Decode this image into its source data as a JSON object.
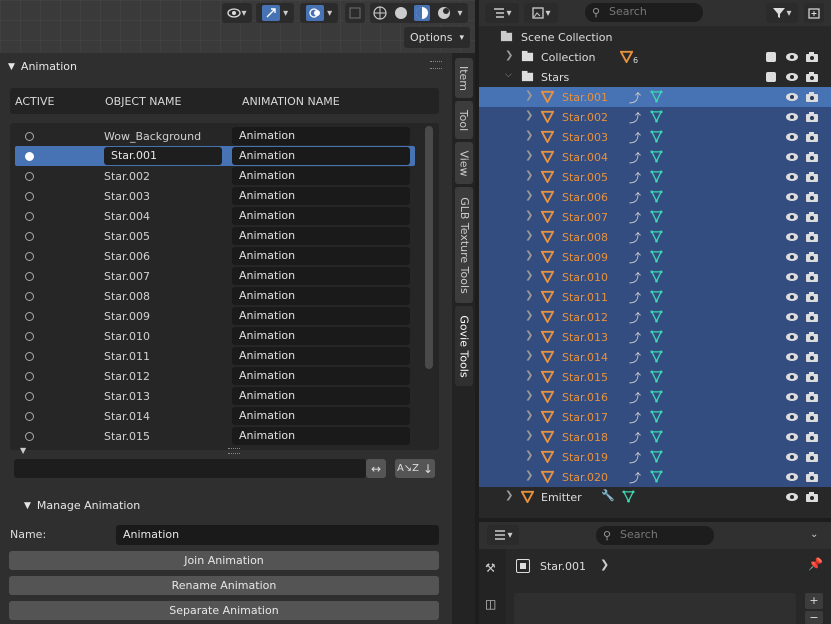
{
  "viewport": {
    "options_label": "Options"
  },
  "panel": {
    "animation_section": "Animation",
    "columns": {
      "active": "ACTIVE",
      "object_name": "OBJECT NAME",
      "animation_name": "ANIMATION NAME"
    },
    "rows": [
      {
        "object": "Wow_Background",
        "animation": "Animation",
        "active": false
      },
      {
        "object": "Star.001",
        "animation": "Animation",
        "active": true
      },
      {
        "object": "Star.002",
        "animation": "Animation",
        "active": false
      },
      {
        "object": "Star.003",
        "animation": "Animation",
        "active": false
      },
      {
        "object": "Star.004",
        "animation": "Animation",
        "active": false
      },
      {
        "object": "Star.005",
        "animation": "Animation",
        "active": false
      },
      {
        "object": "Star.006",
        "animation": "Animation",
        "active": false
      },
      {
        "object": "Star.007",
        "animation": "Animation",
        "active": false
      },
      {
        "object": "Star.008",
        "animation": "Animation",
        "active": false
      },
      {
        "object": "Star.009",
        "animation": "Animation",
        "active": false
      },
      {
        "object": "Star.010",
        "animation": "Animation",
        "active": false
      },
      {
        "object": "Star.011",
        "animation": "Animation",
        "active": false
      },
      {
        "object": "Star.012",
        "animation": "Animation",
        "active": false
      },
      {
        "object": "Star.013",
        "animation": "Animation",
        "active": false
      },
      {
        "object": "Star.014",
        "animation": "Animation",
        "active": false
      },
      {
        "object": "Star.015",
        "animation": "Animation",
        "active": false
      }
    ],
    "manage_section": "Manage Animation",
    "name_label": "Name:",
    "name_value": "Animation",
    "join_button": "Join Animation",
    "rename_button": "Rename Animation",
    "separate_button": "Separate Animation"
  },
  "sidetabs": [
    "Item",
    "Tool",
    "View",
    "GLB Texture Tools",
    "Govie Tools"
  ],
  "outliner": {
    "search_placeholder": "Search",
    "scene_collection": "Scene Collection",
    "collection": "Collection",
    "collection_count": "6",
    "stars": "Stars",
    "stars_children": [
      "Star.001",
      "Star.002",
      "Star.003",
      "Star.004",
      "Star.005",
      "Star.006",
      "Star.007",
      "Star.008",
      "Star.009",
      "Star.010",
      "Star.011",
      "Star.012",
      "Star.013",
      "Star.014",
      "Star.015",
      "Star.016",
      "Star.017",
      "Star.018",
      "Star.019",
      "Star.020"
    ],
    "emitter": "Emitter"
  },
  "properties": {
    "search_placeholder": "Search",
    "object_name": "Star.001"
  },
  "colors": {
    "accent": "#4772b3",
    "object_orange": "#e6913d",
    "mesh_teal": "#3dd6b0"
  }
}
